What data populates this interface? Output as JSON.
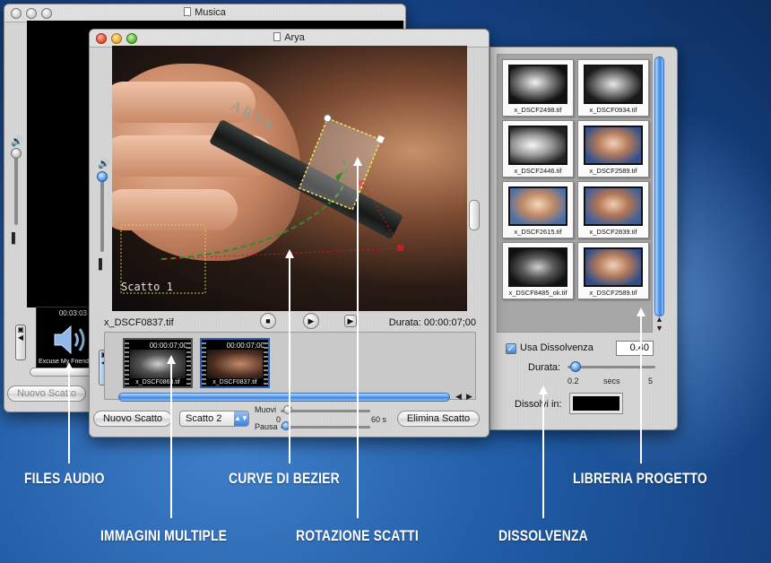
{
  "colors": {
    "desktop": "#1f5aa3",
    "accent_blue": "#3b82db",
    "selection_red": "#d8171b",
    "bezier_green": "#2e8b2e",
    "rotation_yellow": "#f2e25a"
  },
  "musica_window": {
    "title": "Musica",
    "audio_clip": {
      "time": "00:03:03",
      "name": "Excuse My Friend"
    },
    "nuovo_scatto_label": "Nuovo Scatto"
  },
  "arya_window": {
    "title": "Arya",
    "preview": {
      "scatto_label": "Scatto 1",
      "pencil_brand": "ARYA"
    },
    "current_file": "x_DSCF0837.tif",
    "duration": "Durata: 00:00:07;00",
    "clips": [
      {
        "time": "00:00:07;00",
        "name": "x_DSCF0863.tif"
      },
      {
        "time": "00:00:07;00",
        "name": "x_DSCF0837.tif"
      }
    ],
    "buttons": {
      "nuovo_scatto": "Nuovo Scatto",
      "elimina_scatto": "Elimina Scatto"
    },
    "scatto_select": {
      "value": "Scatto 2"
    },
    "movement": {
      "muovi": "Muovi",
      "pausa": "Pausa",
      "min": "0",
      "max": "60 s"
    }
  },
  "library": {
    "thumbs": [
      {
        "name": "x_DSCF2498.tif"
      },
      {
        "name": "x_DSCF0934.tif"
      },
      {
        "name": "x_DSCF2446.tif"
      },
      {
        "name": "x_DSCF2589.tif"
      },
      {
        "name": "x_DSCF2615.tif"
      },
      {
        "name": "x_DSCF2839.tif"
      },
      {
        "name": "x_DSCF8485_ok.tif"
      },
      {
        "name": "x_DSCF2589.tif"
      }
    ],
    "usa_dissolvenza": "Usa Dissolvenza",
    "usa_dissolvenza_value": "0.40",
    "durata_label": "Durata:",
    "durata_min": "0.2",
    "durata_unit": "secs",
    "durata_max": "5",
    "dissolvi_in": "Dissolvi in:",
    "dissolvi_color": "#000000"
  },
  "callouts": {
    "files_audio": "FILES AUDIO",
    "immagini_multiple": "IMMAGINI MULTIPLE",
    "curve_di_bezier": "CURVE DI BEZIER",
    "rotazione_scatti": "ROTAZIONE SCATTI",
    "dissolvenza": "DISSOLVENZA",
    "libreria_progetto": "LIBRERIA PROGETTO"
  }
}
